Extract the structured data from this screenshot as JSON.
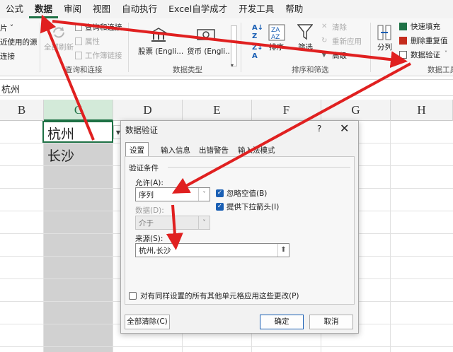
{
  "tabs": [
    "公式",
    "数据",
    "审阅",
    "视图",
    "自动执行",
    "Excel自学成才",
    "开发工具",
    "帮助"
  ],
  "active_tab": "数据",
  "ribbon": {
    "get_data": [
      "片 ˅",
      "近使用的源",
      "连接"
    ],
    "refresh_all": "全部刷新",
    "queries": [
      "查询和连接",
      "属性",
      "工作簿链接"
    ],
    "queries_group": "查询和连接",
    "stocks": "股票 (Engli...",
    "currencies": "货币 (Engli...",
    "datatypes_group": "数据类型",
    "sort": "排序",
    "filter": "筛选",
    "clear": "清除",
    "reapply": "重新应用",
    "advanced": "高级",
    "sort_group": "排序和筛选",
    "split": "分列",
    "flash_fill": "快速填充",
    "remove_dup": "删除重复值",
    "validation": "数据验证",
    "tools_group": "数据工具"
  },
  "formula_value": "杭州",
  "columns": [
    "B",
    "C",
    "D",
    "E",
    "F",
    "G",
    "H"
  ],
  "cells": [
    "杭州",
    "长沙"
  ],
  "dialog": {
    "title": "数据验证",
    "help": "?",
    "close": "✕",
    "tabs": [
      "设置",
      "输入信息",
      "出错警告",
      "输入法模式"
    ],
    "section": "验证条件",
    "allow_label": "允许(A):",
    "allow_value": "序列",
    "ignore_blank": "忽略空值(B)",
    "dropdown": "提供下拉箭头(I)",
    "data_label": "数据(D):",
    "data_value": "介于",
    "source_label": "来源(S):",
    "source_value": "杭州,长沙",
    "apply_all": "对有同样设置的所有其他单元格应用这些更改(P)",
    "clear_all": "全部清除(C)",
    "ok": "确定",
    "cancel": "取消"
  }
}
